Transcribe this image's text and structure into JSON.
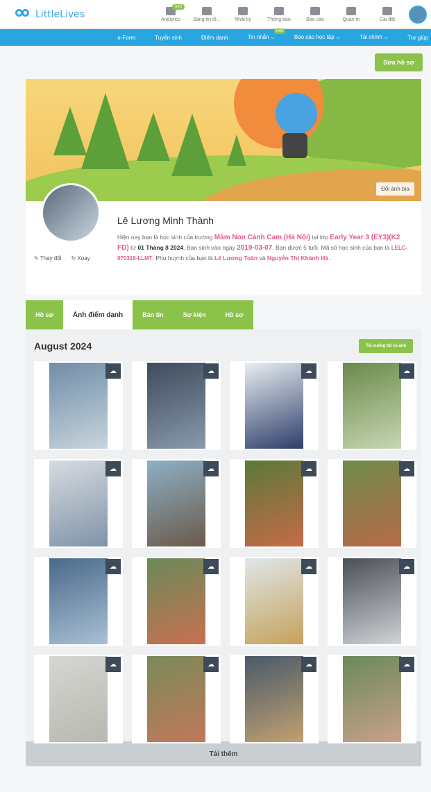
{
  "brand": {
    "name": "LittleLives"
  },
  "nav": {
    "icons": [
      {
        "label": "Analytics",
        "badge": "mới",
        "icon": "analytics-icon"
      },
      {
        "label": "Bảng tin tổ...",
        "badge": "",
        "icon": "newsboard-icon"
      },
      {
        "label": "Nhật ký",
        "badge": "",
        "icon": "diary-icon"
      },
      {
        "label": "Thông báo",
        "badge": "",
        "icon": "bell-icon"
      },
      {
        "label": "Báo cáo",
        "badge": "",
        "icon": "report-icon"
      },
      {
        "label": "Quản trị",
        "badge": "",
        "icon": "admin-icon"
      },
      {
        "label": "Cài đặt",
        "badge": "",
        "icon": "gear-icon"
      }
    ],
    "subnav": [
      "e-Form",
      "Tuyển sinh",
      "Điểm danh",
      "Tin nhắn ⌵",
      "Báo cáo học tập ⌵",
      "Tài chính ⌵",
      "Trợ giúp"
    ],
    "subnav_badge": "mới"
  },
  "edit_button": "Sửa hồ sơ",
  "cover_button": "Đổi ảnh bìa",
  "profile": {
    "change": "Thay đổi",
    "remove": "Xoay",
    "name": "Lê Lương Minh Thành",
    "bio_1": "Hiện nay bạn là học sinh của trường ",
    "school": "Mầm Non Cánh Cam (Hà Nội)",
    "bio_2": " tại lớp ",
    "class": "Early Year 3 (EY3)(K2 FD)",
    "bio_3": " từ ",
    "since": "01 Tháng 8 2024",
    "bio_4": ". Bạn sinh vào ngày ",
    "dob": "2019-03-07",
    "bio_5": ". Bạn được 5 tuổi. Mã số học sinh của bạn là ",
    "student_id": "LELC-070319-LLMT",
    "bio_6": ". Phụ huynh của bạn là ",
    "parent1": "Lê Lương Toàn",
    "bio_7": " và ",
    "parent2": "Nguyễn Thị Khánh Hà",
    "bio_8": " ."
  },
  "tabs": [
    "Hồ sơ",
    "Ảnh điểm danh",
    "Bản tin",
    "Sự kiện",
    "Hồ sơ"
  ],
  "gallery": {
    "month": "August 2024",
    "download_all": "Tải xuống tất cả ảnh",
    "photos": [
      {
        "c1": "#6f8da8",
        "c2": "#c8d4dc"
      },
      {
        "c1": "#3d4b5c",
        "c2": "#8a9aab"
      },
      {
        "c1": "#e8eef2",
        "c2": "#2e3d6a"
      },
      {
        "c1": "#6a8a4a",
        "c2": "#c7d6b3"
      },
      {
        "c1": "#d7dbe0",
        "c2": "#7f93a8"
      },
      {
        "c1": "#8db0c6",
        "c2": "#6b5a4a"
      },
      {
        "c1": "#5a7a3a",
        "c2": "#c76a48"
      },
      {
        "c1": "#6d8c4a",
        "c2": "#b86a4a"
      },
      {
        "c1": "#4a6a8a",
        "c2": "#a8c0d4"
      },
      {
        "c1": "#6a8a5a",
        "c2": "#c87050"
      },
      {
        "c1": "#e0e6ea",
        "c2": "#c4a25a"
      },
      {
        "c1": "#4a4f56",
        "c2": "#d0d4d8"
      },
      {
        "c1": "#d6d6d2",
        "c2": "#b8b8b0"
      },
      {
        "c1": "#7a8a5a",
        "c2": "#c0785a"
      },
      {
        "c1": "#4a5a6a",
        "c2": "#c0a070"
      },
      {
        "c1": "#6a8a5a",
        "c2": "#c9a08a"
      }
    ]
  },
  "load_more": "Tải thêm"
}
